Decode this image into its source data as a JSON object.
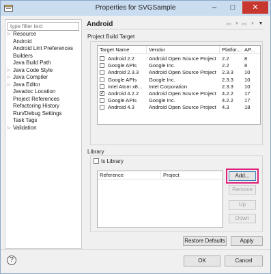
{
  "window": {
    "title": "Properties for SVGSample"
  },
  "filter": {
    "placeholder": "type filter text"
  },
  "tree": [
    {
      "label": "Resource",
      "expandable": true
    },
    {
      "label": "Android",
      "expandable": false
    },
    {
      "label": "Android Lint Preferences",
      "expandable": false
    },
    {
      "label": "Builders",
      "expandable": false
    },
    {
      "label": "Java Build Path",
      "expandable": false
    },
    {
      "label": "Java Code Style",
      "expandable": true
    },
    {
      "label": "Java Compiler",
      "expandable": true
    },
    {
      "label": "Java Editor",
      "expandable": true
    },
    {
      "label": "Javadoc Location",
      "expandable": false
    },
    {
      "label": "Project References",
      "expandable": false
    },
    {
      "label": "Refactoring History",
      "expandable": false
    },
    {
      "label": "Run/Debug Settings",
      "expandable": false
    },
    {
      "label": "Task Tags",
      "expandable": false
    },
    {
      "label": "Validation",
      "expandable": true
    }
  ],
  "page": {
    "title": "Android"
  },
  "build_target": {
    "group_label": "Project Build Target",
    "columns": [
      "Target Name",
      "Vendor",
      "Platfor...",
      "AP..."
    ],
    "rows": [
      {
        "name": "Android 2.2",
        "vendor": "Android Open Source Project",
        "platform": "2.2",
        "api": "8",
        "checked": false
      },
      {
        "name": "Google APIs",
        "vendor": "Google Inc.",
        "platform": "2.2",
        "api": "8",
        "checked": false
      },
      {
        "name": "Android 2.3.3",
        "vendor": "Android Open Source Project",
        "platform": "2.3.3",
        "api": "10",
        "checked": false
      },
      {
        "name": "Google APIs",
        "vendor": "Google Inc.",
        "platform": "2.3.3",
        "api": "10",
        "checked": false
      },
      {
        "name": "Intel Atom x8...",
        "vendor": "Intel Corporation",
        "platform": "2.3.3",
        "api": "10",
        "checked": false
      },
      {
        "name": "Android 4.2.2",
        "vendor": "Android Open Source Project",
        "platform": "4.2.2",
        "api": "17",
        "checked": true
      },
      {
        "name": "Google APIs",
        "vendor": "Google Inc.",
        "platform": "4.2.2",
        "api": "17",
        "checked": false
      },
      {
        "name": "Android 4.3",
        "vendor": "Android Open Source Project",
        "platform": "4.3",
        "api": "18",
        "checked": false
      }
    ]
  },
  "library": {
    "group_label": "Library",
    "is_library_label": "Is Library",
    "is_library_checked": false,
    "columns": [
      "Reference",
      "Project"
    ],
    "add_label": "Add...",
    "remove_label": "Remove",
    "up_label": "Up",
    "down_label": "Down"
  },
  "actions": {
    "restore_defaults": "Restore Defaults",
    "apply": "Apply",
    "ok": "OK",
    "cancel": "Cancel"
  },
  "colors": {
    "highlight": "#e0207a",
    "titlebar": "#c9dcf0",
    "close": "#c7372f"
  }
}
